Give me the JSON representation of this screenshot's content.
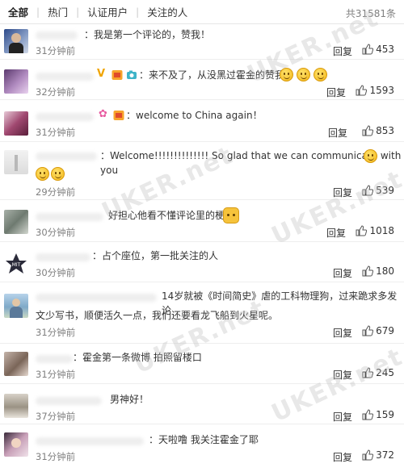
{
  "tabs": {
    "all": "全部",
    "hot": "热门",
    "verified": "认证用户",
    "followed": "关注的人"
  },
  "total_count": "共31581条",
  "reply_label": "回复",
  "watermark": "UKER.net",
  "comments": [
    {
      "text": "：我是第一个评论的，赞我！",
      "time": "31分钟前",
      "likes": "453"
    },
    {
      "text": "：来不及了，从没黑过霍金的赞我",
      "time": "32分钟前",
      "likes": "1593"
    },
    {
      "text": "：welcome to China again！",
      "time": "31分钟前",
      "likes": "853"
    },
    {
      "text": "：Welcome!!!!!!!!!!!!!! So glad that we can communicate with you",
      "time": "29分钟前",
      "likes": "539"
    },
    {
      "text": "好担心他看不懂评论里的梗",
      "time": "30分钟前",
      "likes": "1018"
    },
    {
      "text": "：占个座位，第一批关注的人",
      "time": "30分钟前",
      "likes": "180"
    },
    {
      "text_line1": "14岁就被《时间简史》虐的工科物理狗，过来跪求多发论",
      "text_line2": "文少写书，顺便活久一点，我们还要看龙飞船到火星呢。",
      "time": "31分钟前",
      "likes": "679"
    },
    {
      "text": "：霍金第一条微博 拍照留楼口",
      "time": "31分钟前",
      "likes": "245"
    },
    {
      "text": "男神好！",
      "time": "37分钟前",
      "likes": "159"
    },
    {
      "text": "：天啦噜 我关注霍金了耶",
      "time": "31分钟前",
      "likes": "372"
    }
  ]
}
